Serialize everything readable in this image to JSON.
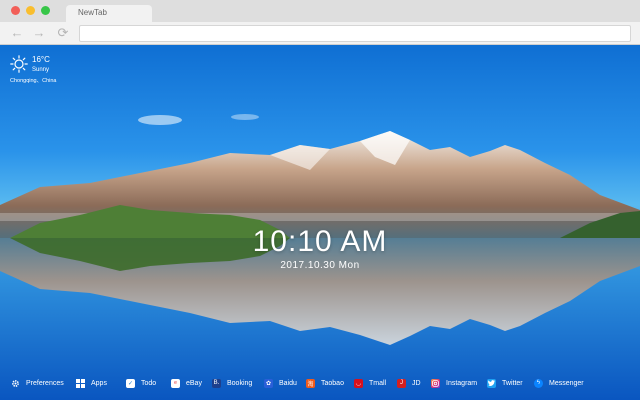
{
  "browser": {
    "tab_title": "NewTab",
    "nav": {
      "back_glyph": "←",
      "forward_glyph": "→",
      "reload_glyph": "⟳"
    }
  },
  "weather": {
    "temperature": "16°C",
    "condition": "Sunny",
    "location": "Chongqing、China",
    "icon": "sun-icon"
  },
  "clock": {
    "time": "10:10 AM",
    "date": "2017.10.30 Mon"
  },
  "bottom_bar": {
    "items": [
      {
        "label": "Preferences",
        "icon": "gear-icon",
        "color": "#ffffff"
      },
      {
        "label": "Apps",
        "icon": "apps-grid-icon",
        "color": "#ffffff"
      },
      {
        "label": "Todo",
        "icon": "checkbox-icon",
        "color": "#ffffff"
      },
      {
        "label": "eBay",
        "icon": "ebay-icon",
        "color": "#ffffff"
      },
      {
        "label": "Booking",
        "icon": "booking-icon",
        "color": "#1d3f8c"
      },
      {
        "label": "Baidu",
        "icon": "baidu-icon",
        "color": "#2a5fd8"
      },
      {
        "label": "Taobao",
        "icon": "taobao-icon",
        "color": "#f05a1a"
      },
      {
        "label": "Tmall",
        "icon": "tmall-icon",
        "color": "#d8101c"
      },
      {
        "label": "JD",
        "icon": "jd-icon",
        "color": "#d41f1f"
      },
      {
        "label": "Instagram",
        "icon": "instagram-icon",
        "color": "#d62d7a"
      },
      {
        "label": "Twitter",
        "icon": "twitter-icon",
        "color": "#1da1f2"
      },
      {
        "label": "Messenger",
        "icon": "messenger-icon",
        "color": "#0a84ff"
      }
    ]
  }
}
